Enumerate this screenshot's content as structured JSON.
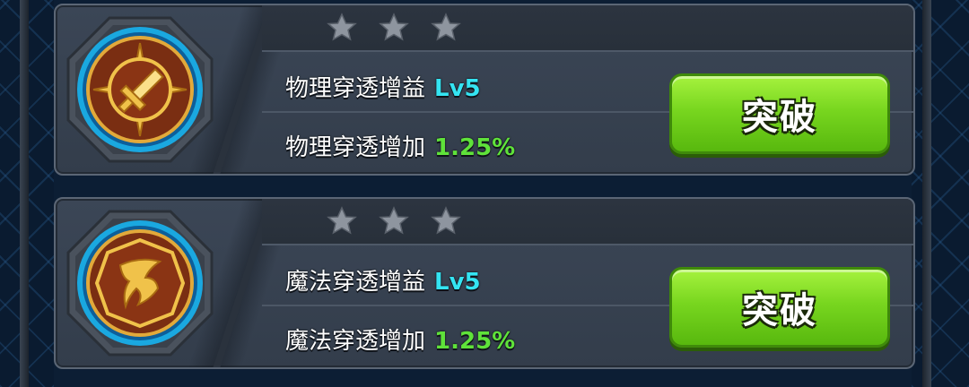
{
  "colors": {
    "accent_level": "#34e4f2",
    "accent_percent": "#5fe23a",
    "button_green": "#78d61f",
    "star_inactive": "#8e959f"
  },
  "skills": [
    {
      "icon": "sword-icon",
      "stars_total": 3,
      "stars_filled": 0,
      "buff_label": "物理穿透增益",
      "buff_level": "Lv5",
      "increase_label": "物理穿透增加",
      "increase_value": "1.25%",
      "button_label": "突破"
    },
    {
      "icon": "magic-rune-icon",
      "stars_total": 3,
      "stars_filled": 0,
      "buff_label": "魔法穿透增益",
      "buff_level": "Lv5",
      "increase_label": "魔法穿透增加",
      "increase_value": "1.25%",
      "button_label": "突破"
    }
  ]
}
